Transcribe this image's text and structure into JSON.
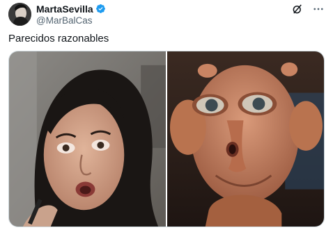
{
  "author": {
    "display_name": "MartaSevilla",
    "handle": "@MarBalCas",
    "verified": true,
    "avatar_icon": "profile-photo"
  },
  "tweet": {
    "text": "Parecidos razonables"
  },
  "media": [
    {
      "icon": "photo-woman-speaking"
    },
    {
      "icon": "photo-alien-creature"
    }
  ],
  "colors": {
    "verified": "#1d9bf0",
    "secondary_text": "#536471",
    "primary_text": "#0f1419"
  },
  "icons": {
    "grok": "grok-icon",
    "more": "more-icon"
  }
}
